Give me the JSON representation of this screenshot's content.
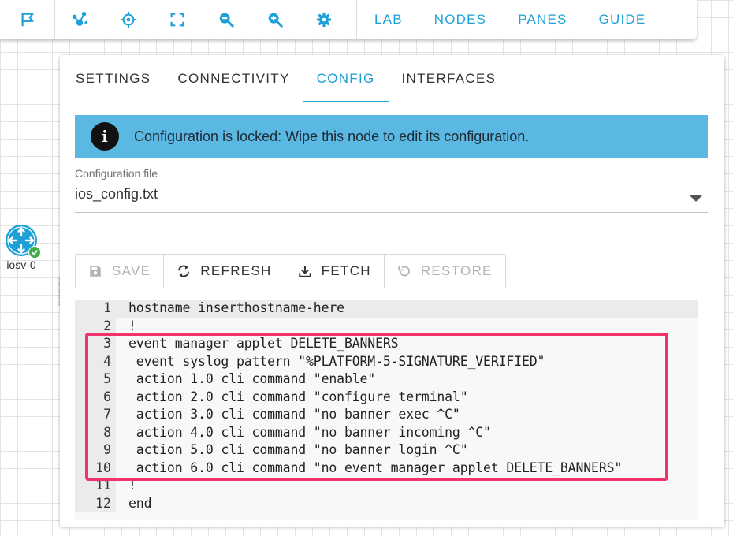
{
  "toolbar": {
    "icons": [
      "flag-icon",
      "share-node-icon",
      "target-icon",
      "fit-screen-icon",
      "zoom-out-icon",
      "zoom-in-icon",
      "gear-icon"
    ],
    "menu": [
      "LAB",
      "NODES",
      "PANES",
      "GUIDE"
    ]
  },
  "node": {
    "label": "iosv-0"
  },
  "panel": {
    "tabs": [
      "SETTINGS",
      "CONNECTIVITY",
      "CONFIG",
      "INTERFACES"
    ],
    "active_tab": "CONFIG",
    "banner": {
      "icon_glyph": "i",
      "text": "Configuration is locked: Wipe this node to edit its configuration."
    },
    "config_file": {
      "label": "Configuration file",
      "value": "ios_config.txt"
    },
    "buttons": {
      "save": "SAVE",
      "refresh": "REFRESH",
      "fetch": "FETCH",
      "restore": "RESTORE"
    },
    "editor": {
      "lines": [
        {
          "n": "1",
          "text": "hostname inserthostname-here"
        },
        {
          "n": "2",
          "text": "!"
        },
        {
          "n": "3",
          "text": "event manager applet DELETE_BANNERS"
        },
        {
          "n": "4",
          "text": " event syslog pattern \"%PLATFORM-5-SIGNATURE_VERIFIED\""
        },
        {
          "n": "5",
          "text": " action 1.0 cli command \"enable\""
        },
        {
          "n": "6",
          "text": " action 2.0 cli command \"configure terminal\""
        },
        {
          "n": "7",
          "text": " action 3.0 cli command \"no banner exec ^C\""
        },
        {
          "n": "8",
          "text": " action 4.0 cli command \"no banner incoming ^C\""
        },
        {
          "n": "9",
          "text": " action 5.0 cli command \"no banner login ^C\""
        },
        {
          "n": "10",
          "text": " action 6.0 cli command \"no event manager applet DELETE_BANNERS\""
        },
        {
          "n": "11",
          "text": "!"
        },
        {
          "n": "12",
          "text": "end"
        }
      ]
    }
  },
  "colors": {
    "accent": "#1ba0d7",
    "banner": "#5bb8e2",
    "highlight": "#f0336a",
    "node_ok": "#3fae49"
  }
}
